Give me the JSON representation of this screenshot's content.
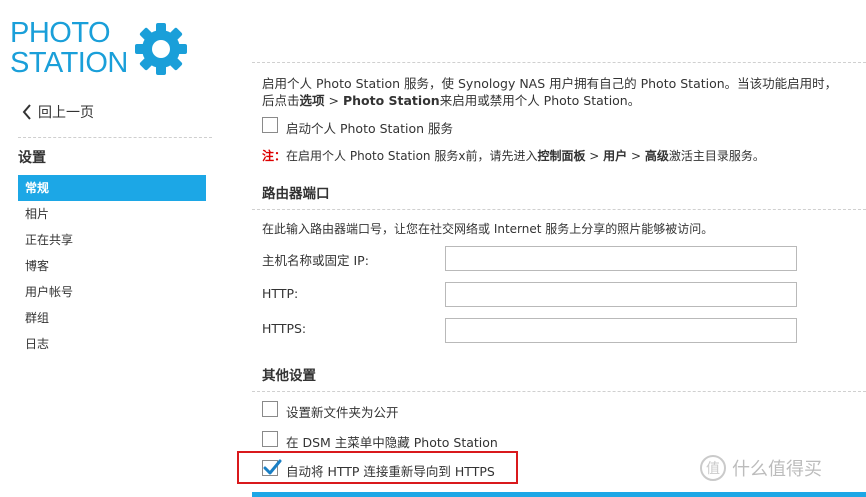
{
  "app": {
    "logo_line1": "PHOTO",
    "logo_line2": "STATION",
    "accent_color": "#1ca7e6"
  },
  "sidebar": {
    "back_label": "回上一页",
    "section_title": "设置",
    "items": [
      {
        "label": "常规",
        "active": true
      },
      {
        "label": "相片"
      },
      {
        "label": "正在共享"
      },
      {
        "label": "博客"
      },
      {
        "label": "用户帐号"
      },
      {
        "label": "群组"
      },
      {
        "label": "日志"
      }
    ]
  },
  "personal": {
    "desc_line1": "启用个人 Photo Station 服务，使 Synology NAS 用户拥有自己的 Photo Station。当该功能启用时，",
    "desc_line2_pre": "后点击",
    "desc_line2_options": "选项",
    "desc_line2_sep": " > ",
    "desc_line2_ps": "Photo Station",
    "desc_line2_post": "来启用或禁用个人 Photo Station。",
    "checkbox_label": "启动个人 Photo Station 服务",
    "note_prefix": "注：",
    "note_pre": "在启用个人 Photo Station 服务x前，请先进入",
    "note_control_panel": "控制面板",
    "note_sep1": " > ",
    "note_user": "用户",
    "note_sep2": " > ",
    "note_advanced": "高级",
    "note_post": "激活主目录服务。"
  },
  "router": {
    "title": "路由器端口",
    "desc": "在此输入路由器端口号，让您在社交网络或 Internet 服务上分享的照片能够被访问。",
    "host_label": "主机名称或固定 IP:",
    "host_value": "",
    "http_label": "HTTP:",
    "http_value": "",
    "https_label": "HTTPS:",
    "https_value": ""
  },
  "other": {
    "title": "其他设置",
    "public_label": "设置新文件夹为公开",
    "hide_label": "在 DSM 主菜单中隐藏 Photo Station",
    "redirect_label": "自动将 HTTP 连接重新导向到 HTTPS",
    "redirect_checked": true
  },
  "watermark": {
    "icon": "值",
    "text": "什么值得买"
  }
}
